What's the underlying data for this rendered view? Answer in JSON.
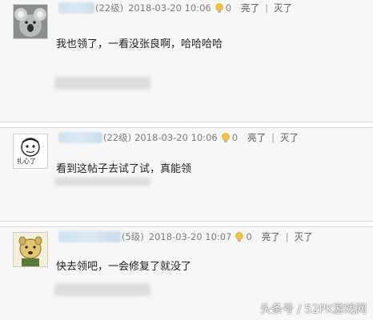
{
  "comments": [
    {
      "avatar": "koala-avatar",
      "level": "(22级)",
      "datetime": "2018-03-20 10:06",
      "likes": "0",
      "bright_label": "亮了",
      "dim_label": "灭了",
      "content": "我也领了，一看没张良啊，哈哈哈哈"
    },
    {
      "avatar": "cartoon-face-avatar",
      "avatar_caption": "扎心了",
      "level": "(22级)",
      "datetime": "2018-03-20 10:06",
      "likes": "0",
      "bright_label": "亮了",
      "dim_label": "灭了",
      "content": "看到这帖子去试了试，真能领"
    },
    {
      "avatar": "doge-avatar",
      "level": "(5级)",
      "datetime": "2018-03-20 10:07",
      "likes": "0",
      "bright_label": "亮了",
      "dim_label": "灭了",
      "content": "快去领吧，一会修复了就没了"
    }
  ],
  "watermark": "头条号 / 52PK游戏网",
  "colors": {
    "row_bg": "#f7f7f7",
    "meta_text": "#7d7d7d",
    "blur_name": "#d3e4f1"
  }
}
